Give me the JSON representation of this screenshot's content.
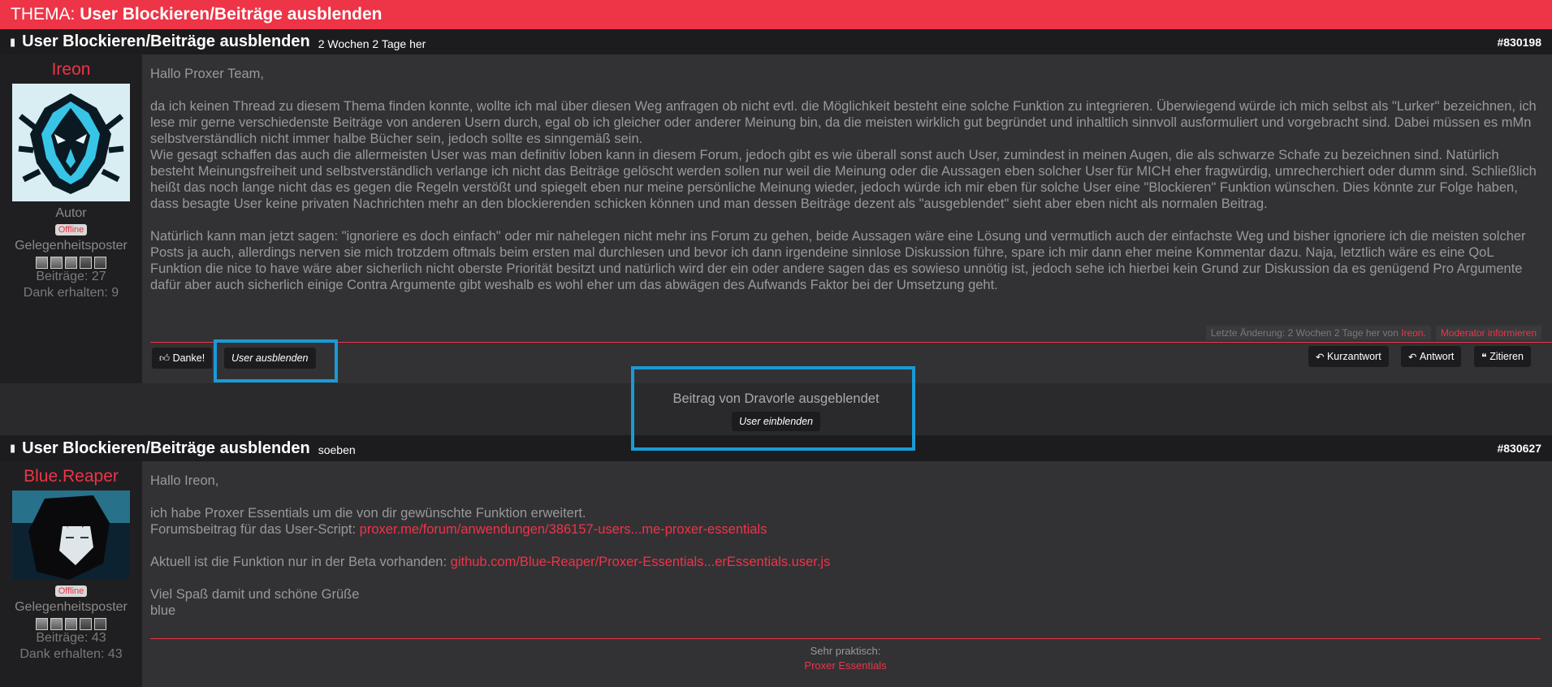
{
  "thread": {
    "prefix": "THEMA:",
    "title": "User Blockieren/Beiträge ausblenden"
  },
  "post1": {
    "title": "User Blockieren/Beiträge ausblenden",
    "time": "2 Wochen 2 Tage her",
    "id": "#830198",
    "user": {
      "name": "Ireon",
      "role": "Autor",
      "status": "Offline",
      "rank": "Gelegenheitsposter",
      "posts": "Beiträge: 27",
      "thanks": "Dank erhalten: 9"
    },
    "greeting": "Hallo Proxer Team,",
    "para1": "da ich keinen Thread zu diesem Thema finden konnte, wollte ich mal über diesen Weg anfragen ob nicht evtl. die Möglichkeit besteht eine solche Funktion zu integrieren. Überwiegend würde ich mich selbst als \"Lurker\" bezeichnen, ich lese mir gerne verschiedenste Beiträge von anderen Usern durch, egal ob ich gleicher oder anderer Meinung bin, da die meisten wirklich gut begründet und inhaltlich sinnvoll ausformuliert und vorgebracht sind. Dabei müssen es mMn selbstverständlich nicht immer halbe Bücher sein, jedoch sollte es sinngemäß sein.",
    "para2": "Wie gesagt schaffen das auch die allermeisten User was man definitiv loben kann in diesem Forum, jedoch gibt es wie überall sonst auch User, zumindest in meinen Augen, die als schwarze Schafe zu bezeichnen sind. Natürlich besteht Meinungsfreiheit und selbstverständlich verlange ich nicht das Beiträge gelöscht werden sollen nur weil die Meinung oder die Aussagen eben solcher User für MICH eher fragwürdig, umrecherchiert oder dumm sind. Schließlich heißt das noch lange nicht das es gegen die Regeln verstößt und spiegelt eben nur meine persönliche Meinung wieder, jedoch würde ich mir eben für solche User eine \"Blockieren\" Funktion wünschen. Dies könnte zur Folge haben, dass besagte User keine privaten Nachrichten mehr an den blockierenden schicken können und man dessen Beiträge dezent als \"ausgeblendet\" sieht aber eben nicht als normalen Beitrag.",
    "para3": "Natürlich kann man jetzt sagen: \"ignoriere es doch einfach\" oder mir nahelegen nicht mehr ins Forum zu gehen, beide Aussagen wäre eine Lösung und vermutlich auch der einfachste Weg und bisher ignoriere ich die meisten solcher Posts ja auch, allerdings nerven sie mich trotzdem oftmals beim ersten mal durchlesen und bevor ich dann irgendeine sinnlose Diskussion führe, spare ich mir dann eher meine Kommentar dazu. Naja, letztlich wäre es eine QoL Funktion die nice to have wäre aber sicherlich nicht oberste Priorität besitzt und natürlich wird der ein oder andere sagen das es sowieso unnötig ist, jedoch sehe ich hierbei kein Grund zur Diskussion da es genügend Pro Argumente dafür aber auch sicherlich einige Contra Argumente gibt weshalb es wohl eher um das abwägen des Aufwands Faktor bei der Umsetzung geht.",
    "lastchange_prefix": "Letzte Änderung: 2 Wochen 2 Tage her von",
    "lastchange_user": "Ireon.",
    "moderator": "Moderator informieren",
    "thanks_btn": "Danke!",
    "hide_btn": "User ausblenden",
    "quick_reply": "Kurzantwort",
    "reply": "Antwort",
    "quote": "Zitieren"
  },
  "hidden": {
    "text": "Beitrag von Dravorle ausgeblendet",
    "show_btn": "User einblenden"
  },
  "post2": {
    "title": "User Blockieren/Beiträge ausblenden",
    "time": "soeben",
    "id": "#830627",
    "user": {
      "name": "Blue.Reaper",
      "status": "Offline",
      "rank": "Gelegenheitsposter",
      "posts": "Beiträge: 43",
      "thanks": "Dank erhalten: 43"
    },
    "greeting": "Hallo Ireon,",
    "line1": "ich habe Proxer Essentials um die von dir gewünschte Funktion erweitert.",
    "line2_prefix": "Forumsbeitrag für das User-Script:",
    "line2_link": "proxer.me/forum/anwendungen/386157-users...me-proxer-essentials",
    "line3_prefix": "Aktuell ist die Funktion nur in der Beta vorhanden:",
    "line3_link": "github.com/Blue-Reaper/Proxer-Essentials...erEssentials.user.js",
    "line4": "Viel Spaß damit und schöne Grüße",
    "line5": "blue",
    "sig_label": "Sehr praktisch:",
    "sig_link": "Proxer Essentials"
  },
  "colors": {
    "accent": "#ee3447",
    "highlight": "#1a9ad6"
  }
}
